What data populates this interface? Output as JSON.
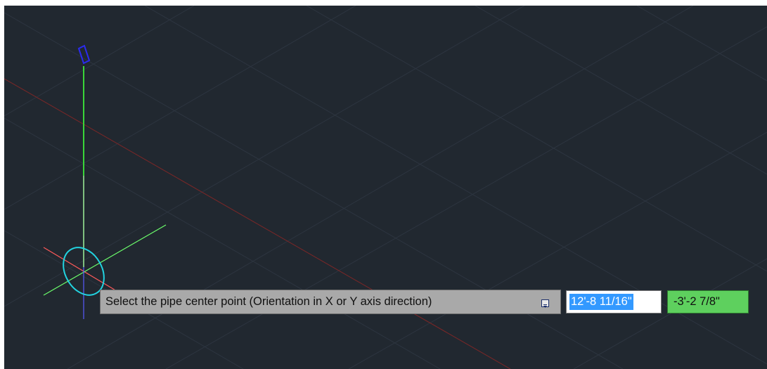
{
  "prompt": {
    "text": "Select the pipe center point (Orientation in X or Y axis direction)",
    "dropdown_icon": "down-arrow-icon"
  },
  "dynamic_input": {
    "x_value": "12'-8 11/16\"",
    "y_value": "-3'-2 7/8\""
  },
  "colors": {
    "background": "#212830",
    "grid": "#2d3540",
    "x_axis": "#8a2a2a",
    "ucs_x": "#ff4040",
    "ucs_y": "#40ff40",
    "ucs_z": "#4040ff",
    "pipe_axis": "#39d639",
    "pipe_circle": "#22d3e0",
    "tooltip_bg": "#a9a9a9",
    "x_input_highlight": "#3399ff",
    "y_input_bg": "#5ed05e"
  }
}
